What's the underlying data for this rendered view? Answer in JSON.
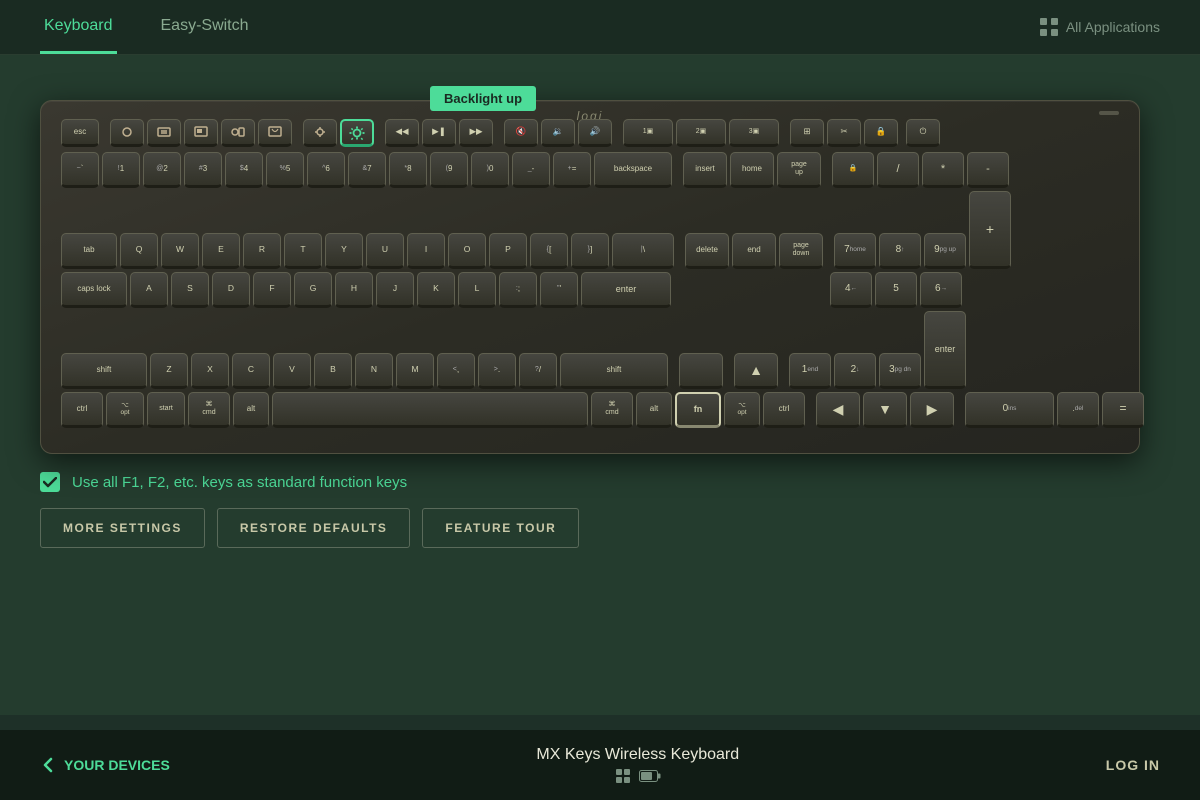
{
  "header": {
    "tab_keyboard": "Keyboard",
    "tab_easyswitch": "Easy-Switch",
    "all_apps_label": "All Applications"
  },
  "keyboard": {
    "brand": "logi",
    "tooltip": "Backlight up"
  },
  "settings": {
    "checkbox_label": "Use all F1, F2, etc. keys as standard function keys",
    "checkbox_checked": true,
    "btn_more": "MORE SETTINGS",
    "btn_restore": "RESTORE DEFAULTS",
    "btn_tour": "FEATURE TOUR"
  },
  "bottom_bar": {
    "your_devices": "YOUR DEVICES",
    "device_name": "MX Keys Wireless Keyboard",
    "log_in": "LOG IN"
  }
}
